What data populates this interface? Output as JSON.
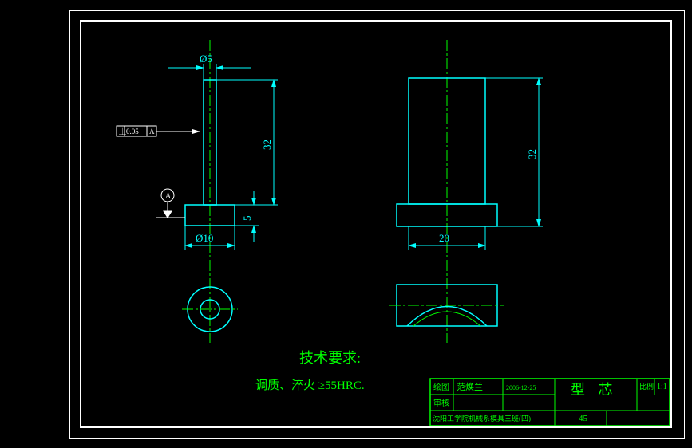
{
  "drawing": {
    "left_view": {
      "dia_top": "Ø5",
      "dia_bottom": "Ø10",
      "height_main": "32",
      "height_base": "5",
      "tolerance_box": "⏊ 0.05 A",
      "datum_label": "A"
    },
    "right_view": {
      "height": "32",
      "width": "20"
    },
    "notes": {
      "title": "技术要求:",
      "line1": "调质、淬火 ≥55HRC."
    }
  },
  "title_block": {
    "labels": {
      "drawn": "绘图",
      "checked": "审核",
      "school": "沈阳工学院机械系模具三班(四)"
    },
    "drawn_by": "范焕兰",
    "date": "2006-12-25",
    "part_name": "型    芯",
    "scale_label": "比例",
    "scale": "1:1",
    "number": "45"
  }
}
